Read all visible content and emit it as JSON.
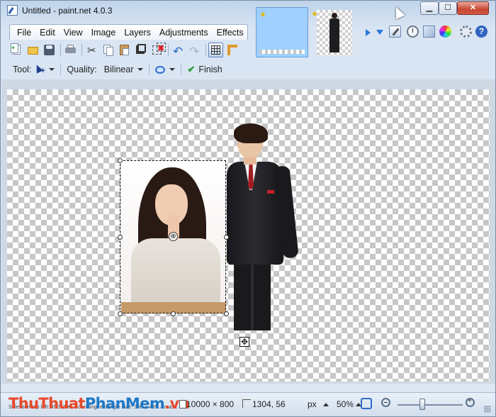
{
  "window": {
    "title": "Untitled - paint.net 4.0.3"
  },
  "window_controls": {
    "minimize": "▁",
    "maximize": "☐",
    "close": "✕"
  },
  "menu": {
    "items": [
      "File",
      "Edit",
      "View",
      "Image",
      "Layers",
      "Adjustments",
      "Effects"
    ]
  },
  "utility_icons": [
    "arrow-right-icon",
    "arrow-down-icon",
    "tools-icon",
    "history-icon",
    "layers-icon",
    "colors-icon",
    "settings-icon",
    "help-icon"
  ],
  "help_glyph": "?",
  "toolbar": {
    "icons": [
      "new-icon",
      "open-icon",
      "save-icon",
      "print-icon",
      "cut-icon",
      "copy-icon",
      "paste-icon",
      "crop-icon",
      "deselect-icon",
      "undo-icon",
      "redo-icon",
      "grid-icon",
      "ruler-icon"
    ],
    "cut_glyph": "✂",
    "undo_glyph": "↶",
    "redo_glyph": "↷",
    "deselect_glyph": "✖"
  },
  "tool_options": {
    "tool_label": "Tool:",
    "quality_label": "Quality:",
    "quality_value": "Bilinear",
    "finish_label": "Finish",
    "finish_glyph": "✔"
  },
  "canvas": {
    "move_handle_glyph": "⊕",
    "move_cursor_glyph": "✥"
  },
  "status": {
    "selection_info": "Selection top left: 450, 200. Bounding rectangle size: 300 × 435. Area:...",
    "image_size": "10000 × 800",
    "cursor_position": "1304, 56",
    "units": "px",
    "zoom": "50%",
    "zoom_level": 0.5
  },
  "watermark": {
    "part1": "ThuThuat",
    "part2": "PhanMem",
    "part3": ".vn"
  },
  "colors": {
    "accent": "#2f6ec9",
    "selection": "#111111",
    "close_button": "#c7452f"
  }
}
